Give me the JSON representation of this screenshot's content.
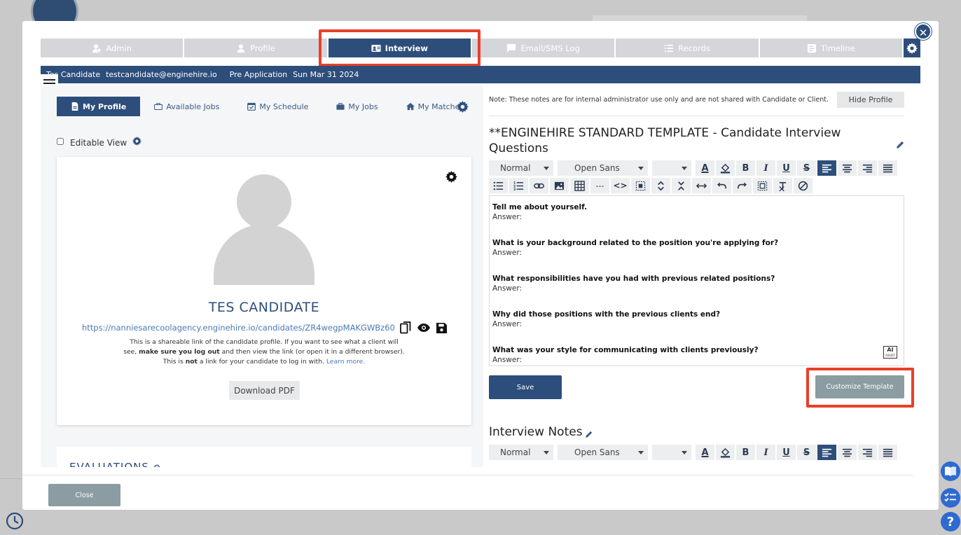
{
  "top_tabs": [
    {
      "label": "Admin",
      "icon": "admin-icon"
    },
    {
      "label": "Profile",
      "icon": "person-icon"
    },
    {
      "label": "Interview",
      "icon": "id-card-icon",
      "active": true
    },
    {
      "label": "Email/SMS Log",
      "icon": "chat-icon"
    },
    {
      "label": "Records",
      "icon": "list-icon"
    },
    {
      "label": "Timeline",
      "icon": "timeline-icon"
    }
  ],
  "info_bar": {
    "name": "Tes Candidate",
    "email": "testcandidate@enginehire.io",
    "status": "Pre Application",
    "date": "Sun Mar 31 2024"
  },
  "sub_tabs": [
    {
      "label": "My Profile",
      "active": true
    },
    {
      "label": "Available Jobs"
    },
    {
      "label": "My Schedule"
    },
    {
      "label": "My Jobs"
    },
    {
      "label": "My Matches"
    }
  ],
  "editable_view": {
    "label": "Editable View",
    "checked": false
  },
  "profile_card": {
    "name": "TES CANDIDATE",
    "link": "https://nanniesarecoolagency.enginehire.io/candidates/ZR4wegpMAKGWBz60",
    "note_1": "This is a shareable link of the candidate profile. If you want to see what a client will",
    "note_2a": "see, ",
    "note_2b": "make sure you log out",
    "note_2c": " and then view the link (or open it in a different browser).",
    "note_3a": "This is ",
    "note_3b": "not",
    "note_3c": " a link for your candidate to log in with. ",
    "learn_more": "Learn more.",
    "download_label": "Download PDF"
  },
  "evaluations": {
    "title": "EVALUATIONS"
  },
  "right": {
    "note": "Note: These notes are for internal administrator use only and are not shared with Candidate or Client.",
    "hide_profile": "Hide Profile",
    "template_title": "**ENGINEHIRE STANDARD TEMPLATE - Candidate Interview Questions",
    "toolbar": {
      "format": "Normal",
      "font": "Open Sans",
      "size": ""
    },
    "questions": [
      "Tell me about yourself.",
      "What is your background related to the position you're applying for?",
      "What responsibilities have you had with previous related positions?",
      "Why did those positions with the previous clients end?",
      "What was your style for communicating with clients previously?"
    ],
    "answer_label": "Answer:",
    "ai_badge": "AI",
    "ai_badge_sub": "ASSIST",
    "save_label": "Save",
    "customize_label": "Customize Template",
    "notes_title": "Interview Notes"
  },
  "footer": {
    "close_label": "Close"
  },
  "colors": {
    "primary": "#2d4e7b",
    "highlight": "#e8402a",
    "link": "#4b79b8",
    "muted_button": "#8b9ca2"
  }
}
